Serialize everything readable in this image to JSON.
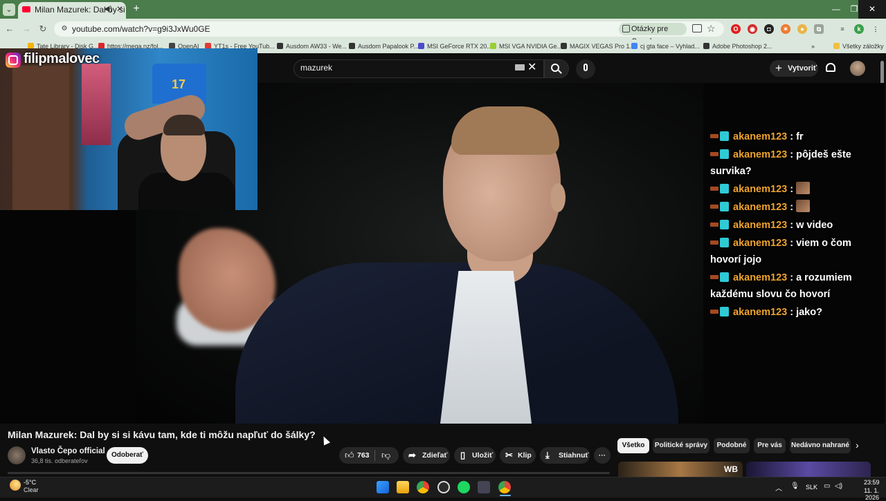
{
  "browser": {
    "tab_title": "Milan Mazurek: Dal by si si",
    "url": "youtube.com/watch?v=g9i3JxWu0GE",
    "google_chip": "Otázky pre Google",
    "bookmarks": [
      {
        "label": "Tate Library - Disk G...",
        "color": "#f4b400"
      },
      {
        "label": "https://mega.nz/fol...",
        "color": "#d9272e"
      },
      {
        "label": "OpenAI",
        "color": "#444444"
      },
      {
        "label": "YT1s - Free YouTub...",
        "color": "#e53935"
      },
      {
        "label": "Ausdom AW33 - We...",
        "color": "#333333"
      },
      {
        "label": "Ausdom Papalook P...",
        "color": "#333333"
      },
      {
        "label": "MSI GeForce RTX 20...",
        "color": "#4a4ad0"
      },
      {
        "label": "MSI VGA NVIDIA Ge...",
        "color": "#9acd32"
      },
      {
        "label": "MAGIX VEGAS Pro 1...",
        "color": "#333333"
      },
      {
        "label": "cj gta face – Vyhlad...",
        "color": "#4285f4"
      },
      {
        "label": "Adobe Photoshop 2...",
        "color": "#333333"
      }
    ],
    "all_bookmarks": "Všetky záložky"
  },
  "youtube": {
    "search_value": "mazurek",
    "create_label": "Vytvoriť",
    "video_title": "Milan Mazurek: Dal by si si kávu tam, kde ti môžu napľuť do šálky?",
    "channel_name": "Vlasto Čepo official",
    "subscribers": "36,8 tis. odberateľov",
    "subscribe_label": "Odoberať",
    "likes": "763",
    "share_label": "Zdieľať",
    "save_label": "Uložiť",
    "clip_label": "Klip",
    "download_label": "Stiahnuť",
    "chips": [
      "Všetko",
      "Politické správy",
      "Podobné",
      "Pre vás",
      "Nedávno nahrané"
    ],
    "thumb_text": "WB"
  },
  "overlay": {
    "instagram_handle": "filipmalovec",
    "chat": [
      {
        "user": "akanem123",
        "text": "fr"
      },
      {
        "user": "akanem123",
        "text": "pôjdeš ešte survika?"
      },
      {
        "user": "akanem123",
        "text": "",
        "emote": true
      },
      {
        "user": "akanem123",
        "text": "",
        "emote": true
      },
      {
        "user": "akanem123",
        "text": "w video"
      },
      {
        "user": "akanem123",
        "text": "viem o čom hovorí jojo"
      },
      {
        "user": "akanem123",
        "text": "a rozumiem každému slovu čo hovorí"
      },
      {
        "user": "akanem123",
        "text": "jako?"
      }
    ]
  },
  "taskbar": {
    "temperature": "-5°C",
    "weather": "Clear",
    "language": "SLK",
    "time": "23:59",
    "date": "11. 1. 2026"
  }
}
